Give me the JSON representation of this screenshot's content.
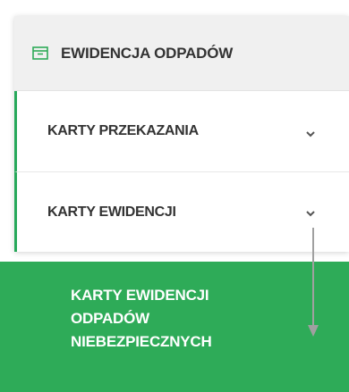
{
  "header": {
    "title": "EWIDENCJA ODPADÓW",
    "icon": "archive-icon"
  },
  "menu": {
    "items": [
      {
        "label": "KARTY PRZEKAZANIA",
        "icon": "chevron-down-icon"
      },
      {
        "label": "KARTY EWIDENCJI",
        "icon": "chevron-down-icon"
      }
    ],
    "active_item": {
      "label": "KARTY EWIDENCJI ODPADÓW NIEBEZPIECZNYCH"
    }
  },
  "colors": {
    "accent": "#2eab58",
    "header_bg": "#f0f0f0",
    "text": "#333333",
    "arrow": "#999999"
  }
}
